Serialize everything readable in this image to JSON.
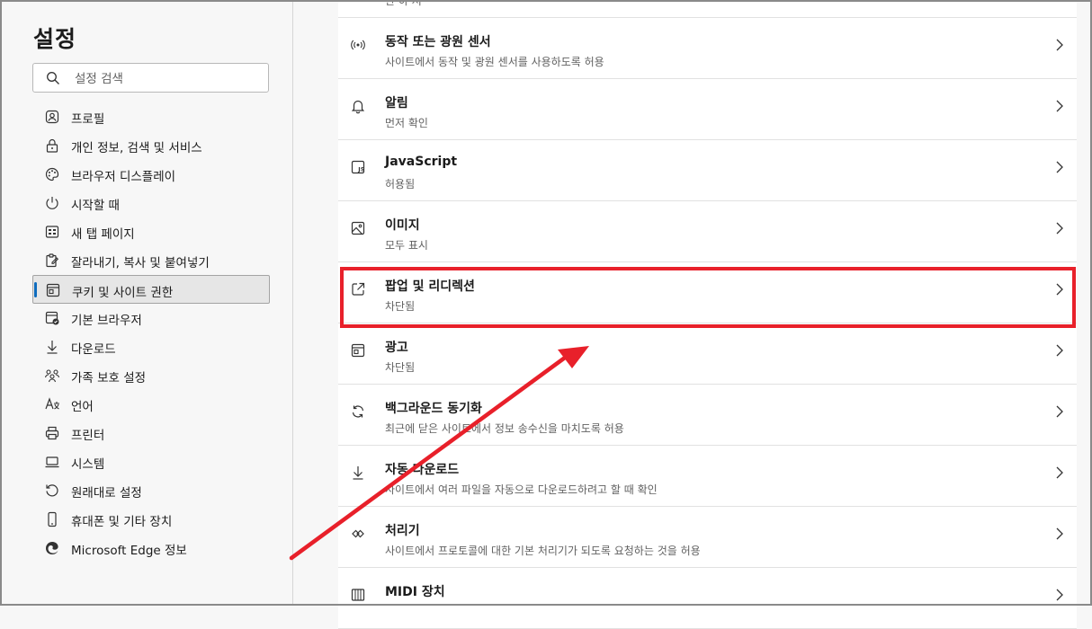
{
  "sidebar": {
    "title": "설정",
    "search": {
      "placeholder": "설정 검색",
      "value": ""
    },
    "items": [
      {
        "label": "프로필",
        "icon": "profile-icon"
      },
      {
        "label": "개인 정보, 검색 및 서비스",
        "icon": "lock-icon"
      },
      {
        "label": "브라우저 디스플레이",
        "icon": "palette-icon"
      },
      {
        "label": "시작할 때",
        "icon": "power-icon"
      },
      {
        "label": "새 탭 페이지",
        "icon": "new-tab-icon"
      },
      {
        "label": "잘라내기, 복사 및 붙여넣기",
        "icon": "clipboard-icon"
      },
      {
        "label": "쿠키 및 사이트 권한",
        "icon": "cookie-site-icon",
        "active": true
      },
      {
        "label": "기본 브라우저",
        "icon": "default-browser-icon"
      },
      {
        "label": "다운로드",
        "icon": "download-icon"
      },
      {
        "label": "가족 보호 설정",
        "icon": "family-icon"
      },
      {
        "label": "언어",
        "icon": "language-icon"
      },
      {
        "label": "프린터",
        "icon": "printer-icon"
      },
      {
        "label": "시스템",
        "icon": "laptop-icon"
      },
      {
        "label": "원래대로 설정",
        "icon": "reset-icon"
      },
      {
        "label": "휴대폰 및 기타 장치",
        "icon": "phone-icon"
      },
      {
        "label": "Microsoft Edge 정보",
        "icon": "edge-icon"
      }
    ]
  },
  "main": {
    "rows": [
      {
        "title": "",
        "desc": "한 하 저",
        "icon": ""
      },
      {
        "title": "동작 또는 광원 센서",
        "desc": "사이트에서 동작 및 광원 센서를 사용하도록 허용",
        "icon": "sensor-icon"
      },
      {
        "title": "알림",
        "desc": "먼저 확인",
        "icon": "bell-icon"
      },
      {
        "title": "JavaScript",
        "desc": "허용됨",
        "icon": "javascript-icon"
      },
      {
        "title": "이미지",
        "desc": "모두 표시",
        "icon": "image-icon"
      },
      {
        "title": "팝업 및 리디렉션",
        "desc": "차단됨",
        "icon": "popup-icon",
        "highlighted": true
      },
      {
        "title": "광고",
        "desc": "차단됨",
        "icon": "ads-icon"
      },
      {
        "title": "백그라운드 동기화",
        "desc": "최근에 닫은 사이트에서 정보 송수신을 마치도록 허용",
        "icon": "sync-icon"
      },
      {
        "title": "자동 다운로드",
        "desc": "사이트에서 여러 파일을 자동으로 다운로드하려고 할 때 확인",
        "icon": "download-icon"
      },
      {
        "title": "처리기",
        "desc": "사이트에서 프로토콜에 대한 기본 처리기가 되도록 요청하는 것을 허용",
        "icon": "handler-icon"
      },
      {
        "title": "MIDI 장치",
        "desc": "",
        "icon": "midi-icon"
      }
    ]
  },
  "colors": {
    "accent": "#0f6cbd",
    "annotation": "#e8202a"
  }
}
